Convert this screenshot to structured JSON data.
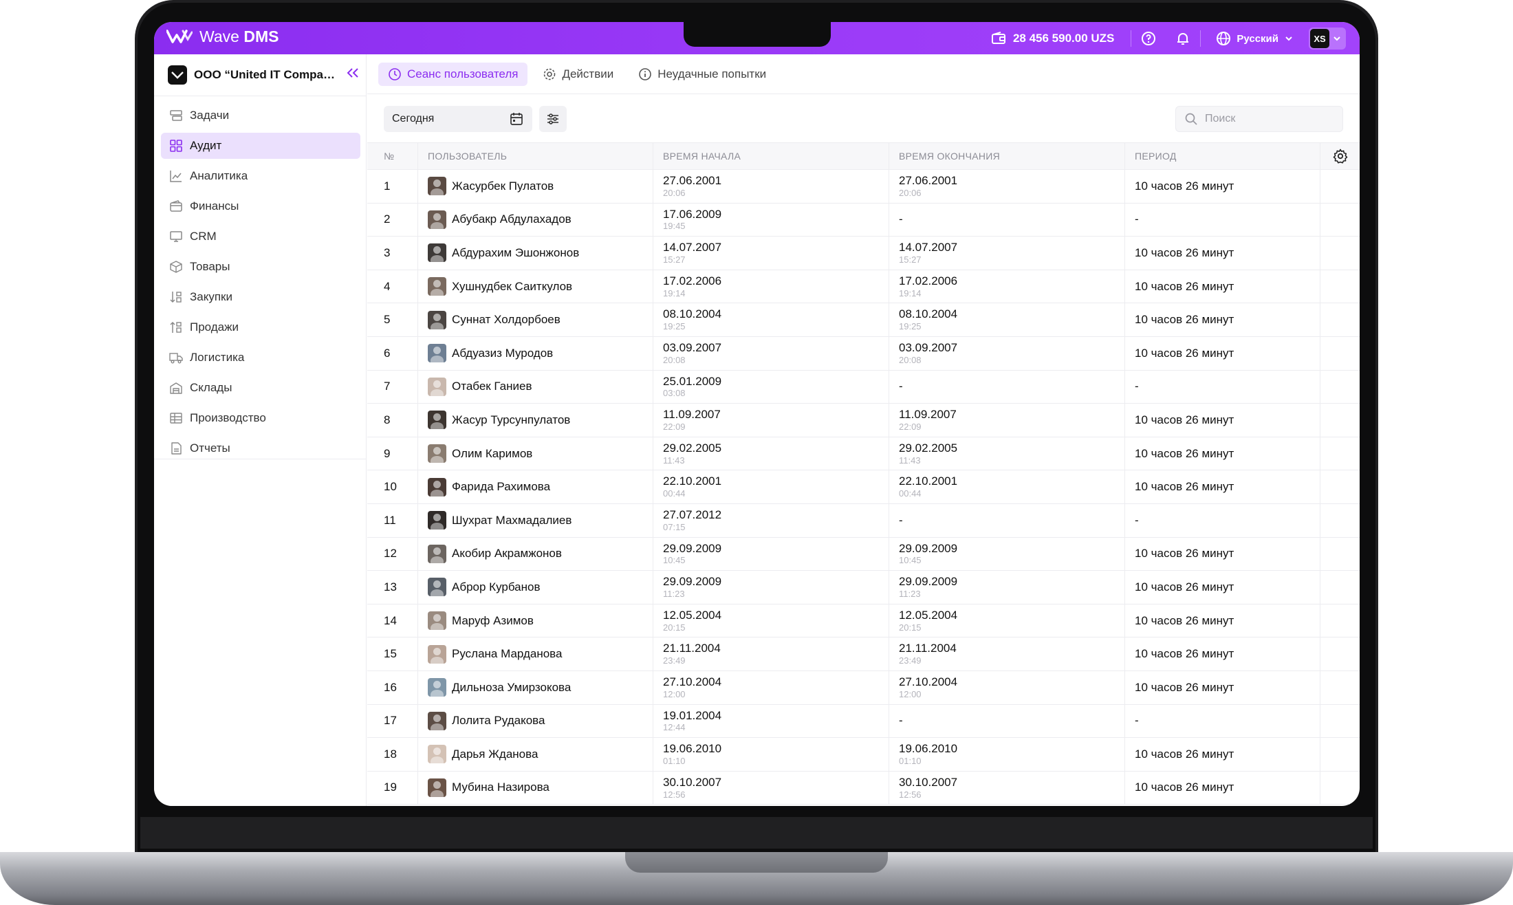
{
  "app": {
    "name_light": "Wave",
    "name_bold": "DMS"
  },
  "topbar": {
    "balance": "28 456 590.00 UZS",
    "language": "Русский",
    "user_initials": "XS"
  },
  "sidebar": {
    "company": "ООО “United IT Company”",
    "items": [
      {
        "label": "Задачи",
        "icon": "tasks-icon"
      },
      {
        "label": "Аудит",
        "icon": "audit-icon",
        "active": true
      },
      {
        "label": "Аналитика",
        "icon": "analytics-icon"
      },
      {
        "label": "Финансы",
        "icon": "wallet-icon"
      },
      {
        "label": "CRM",
        "icon": "monitor-icon"
      },
      {
        "label": "Товары",
        "icon": "box-icon"
      },
      {
        "label": "Закупки",
        "icon": "purchases-icon"
      },
      {
        "label": "Продажи",
        "icon": "sales-icon"
      },
      {
        "label": "Логистика",
        "icon": "truck-icon"
      },
      {
        "label": "Склады",
        "icon": "warehouse-icon"
      },
      {
        "label": "Производство",
        "icon": "production-icon"
      },
      {
        "label": "Отчеты",
        "icon": "report-icon"
      }
    ]
  },
  "tabs": [
    {
      "label": "Сеанс пользователя",
      "active": true
    },
    {
      "label": "Действии"
    },
    {
      "label": "Неудачные попытки"
    }
  ],
  "filters": {
    "date": "Сегодня",
    "search_placeholder": "Поиск"
  },
  "table": {
    "columns": [
      "№",
      "ПОЛЬЗОВАТЕЛЬ",
      "ВРЕМЯ НАЧАЛА",
      "ВРЕМЯ ОКОНЧАНИЯ",
      "ПЕРИОД"
    ],
    "rows": [
      {
        "n": "1",
        "user": "Жасурбек Пулатов",
        "start_date": "27.06.2001",
        "start_time": "20:06",
        "end_date": "27.06.2001",
        "end_time": "20:06",
        "period": "10 часов 26 минут"
      },
      {
        "n": "2",
        "user": "Абубакр Абдулахадов",
        "start_date": "17.06.2009",
        "start_time": "19:45",
        "end_date": "-",
        "end_time": "",
        "period": "-"
      },
      {
        "n": "3",
        "user": "Абдурахим Эшонжонов",
        "start_date": "14.07.2007",
        "start_time": "15:27",
        "end_date": "14.07.2007",
        "end_time": "15:27",
        "period": "10 часов 26 минут"
      },
      {
        "n": "4",
        "user": "Хушнудбек Саиткулов",
        "start_date": "17.02.2006",
        "start_time": "19:14",
        "end_date": "17.02.2006",
        "end_time": "19:14",
        "period": "10 часов 26 минут"
      },
      {
        "n": "5",
        "user": "Суннат Холдорбоев",
        "start_date": "08.10.2004",
        "start_time": "19:25",
        "end_date": "08.10.2004",
        "end_time": "19:25",
        "period": "10 часов 26 минут"
      },
      {
        "n": "6",
        "user": "Абдуазиз Муродов",
        "start_date": "03.09.2007",
        "start_time": "20:08",
        "end_date": "03.09.2007",
        "end_time": "20:08",
        "period": "10 часов 26 минут"
      },
      {
        "n": "7",
        "user": "Отабек Ганиев",
        "start_date": "25.01.2009",
        "start_time": "03:08",
        "end_date": "-",
        "end_time": "",
        "period": "-"
      },
      {
        "n": "8",
        "user": "Жасур Турсунпулатов",
        "start_date": "11.09.2007",
        "start_time": "22:09",
        "end_date": "11.09.2007",
        "end_time": "22:09",
        "period": "10 часов 26 минут"
      },
      {
        "n": "9",
        "user": "Олим Каримов",
        "start_date": "29.02.2005",
        "start_time": "11:43",
        "end_date": "29.02.2005",
        "end_time": "11:43",
        "period": "10 часов 26 минут"
      },
      {
        "n": "10",
        "user": "Фарида Рахимова",
        "start_date": "22.10.2001",
        "start_time": "00:44",
        "end_date": "22.10.2001",
        "end_time": "00:44",
        "period": "10 часов 26 минут"
      },
      {
        "n": "11",
        "user": "Шухрат Махмадалиев",
        "start_date": "27.07.2012",
        "start_time": "07:15",
        "end_date": "-",
        "end_time": "",
        "period": "-"
      },
      {
        "n": "12",
        "user": "Акобир Акрамжонов",
        "start_date": "29.09.2009",
        "start_time": "10:45",
        "end_date": "29.09.2009",
        "end_time": "10:45",
        "period": "10 часов 26 минут"
      },
      {
        "n": "13",
        "user": "Аброр Курбанов",
        "start_date": "29.09.2009",
        "start_time": "11:23",
        "end_date": "29.09.2009",
        "end_time": "11:23",
        "period": "10 часов 26 минут"
      },
      {
        "n": "14",
        "user": "Маруф Азимов",
        "start_date": "12.05.2004",
        "start_time": "20:15",
        "end_date": "12.05.2004",
        "end_time": "20:15",
        "period": "10 часов 26 минут"
      },
      {
        "n": "15",
        "user": "Руслана Марданова",
        "start_date": "21.11.2004",
        "start_time": "23:49",
        "end_date": "21.11.2004",
        "end_time": "23:49",
        "period": "10 часов 26 минут"
      },
      {
        "n": "16",
        "user": "Дильноза Умирзокова",
        "start_date": "27.10.2004",
        "start_time": "12:00",
        "end_date": "27.10.2004",
        "end_time": "12:00",
        "period": "10 часов 26 минут"
      },
      {
        "n": "17",
        "user": "Лолита Рудакова",
        "start_date": "19.01.2004",
        "start_time": "12:44",
        "end_date": "-",
        "end_time": "",
        "period": "-"
      },
      {
        "n": "18",
        "user": "Дарья Жданова",
        "start_date": "19.06.2010",
        "start_time": "01:10",
        "end_date": "19.06.2010",
        "end_time": "01:10",
        "period": "10 часов 26 минут"
      },
      {
        "n": "19",
        "user": "Мубина Назирова",
        "start_date": "30.10.2007",
        "start_time": "12:56",
        "end_date": "30.10.2007",
        "end_time": "12:56",
        "period": "10 часов 26 минут"
      }
    ]
  },
  "colors": {
    "accent": "#8b2df0",
    "active_bg": "#ebe0fd"
  }
}
